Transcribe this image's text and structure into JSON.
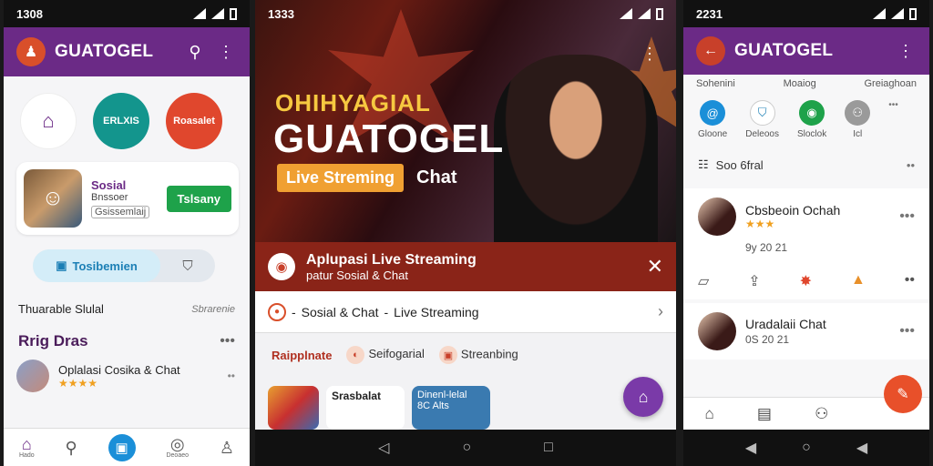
{
  "phone1": {
    "status_time": "1308",
    "app_title": "GUATOGEL",
    "circles": [
      {
        "label": "",
        "color": "#ffffff"
      },
      {
        "label": "ERLXIS",
        "color": "#13958d"
      },
      {
        "label": "Roasalet",
        "color": "#e0472d"
      }
    ],
    "card": {
      "title": "Sosial",
      "subtitle": "Bnssoer",
      "tag": "Gsissemlaij",
      "button": "Tslsany"
    },
    "pill": {
      "active": "Tosibemien"
    },
    "section1": {
      "left": "Thuarable Slulal",
      "right": "Sbrarenie"
    },
    "section2": {
      "title": "Rrig Dras"
    },
    "item": {
      "title": "Oplalasi Cosika & Chat",
      "stars": "★★★★"
    },
    "nav": [
      "Hado",
      "",
      "",
      "Deoaeo",
      ""
    ]
  },
  "phone2": {
    "status_time": "1333",
    "hero_line1": "OHIHYAGIAL",
    "hero_line2": "GUATOGEL",
    "hero_tag": "Live Streming",
    "hero_chat": "Chat",
    "banner_title": "Aplupasi Live Streaming",
    "banner_sub": "patur Sosial & Chat",
    "breadcrumb": [
      "Sosial & Chat",
      "Live Streaming"
    ],
    "chips": [
      "Raipplnate",
      "Seifogarial",
      "Streanbing"
    ],
    "tile_card": "Srasbalat",
    "tile_blue_title": "Dinenl-lelal",
    "tile_blue_sub": "8C Alts"
  },
  "phone3": {
    "status_time": "2231",
    "app_title": "GUATOGEL",
    "tabs": [
      "Sohenini",
      "Moaiog",
      "Greiaghoan"
    ],
    "icons": [
      {
        "label": "Gloone",
        "color": "#1b8fd8"
      },
      {
        "label": "Deleoos",
        "color": "#ffffff"
      },
      {
        "label": "Sloclok",
        "color": "#1ea24a"
      },
      {
        "label": "Icl",
        "color": "#9a9a9a"
      }
    ],
    "row": "Soo 6fral",
    "post1": {
      "name": "Cbsbeoin Ochah",
      "stars": "★★★",
      "meta": "9y 20 21"
    },
    "post2": {
      "name": "Uradalaii Chat",
      "meta": "0S 20 21"
    }
  }
}
